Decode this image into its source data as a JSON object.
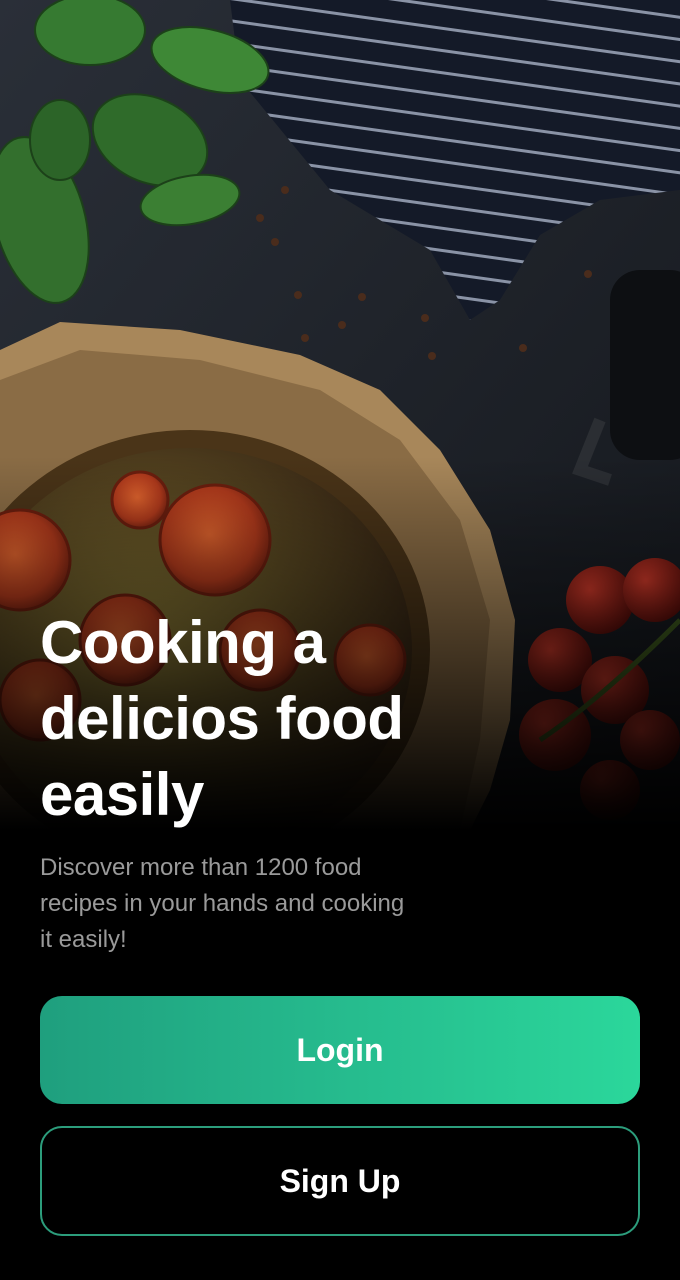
{
  "onboarding": {
    "headline_lines": [
      "Cooking a",
      "delicios food",
      "easily"
    ],
    "subtitle_lines": [
      "Discover more than 1200 food",
      "recipes in your hands and cooking",
      "it easily!"
    ],
    "login_label": "Login",
    "signup_label": "Sign Up"
  },
  "colors": {
    "background": "#000000",
    "accent_start": "#1f9f7e",
    "accent_end": "#2bd79b",
    "signup_border": "#2c9d7c",
    "subtitle": "#9a9a9a"
  }
}
